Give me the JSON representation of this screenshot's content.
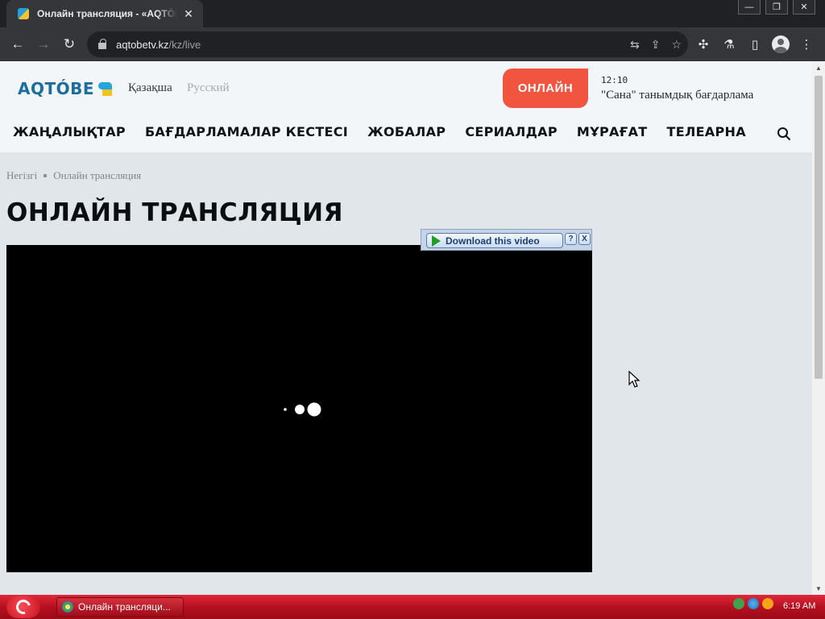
{
  "browser": {
    "tab_title": "Онлайн трансляция - «AQTÓBE",
    "tab_close": "✕",
    "window_controls": {
      "minimize": "—",
      "restore": "❐",
      "close": "✕"
    },
    "url_host": "aqtobetv.kz",
    "url_path": "/kz/live",
    "nav": {
      "back": "←",
      "forward": "→",
      "reload": "↻"
    },
    "omnibox_icons": {
      "translate": "⇆",
      "share": "⇪",
      "bookmark": "☆"
    },
    "toolbar_icons": {
      "extensions": "✣",
      "labs": "⚗",
      "sidepanel": "▯",
      "menu": "⋮"
    }
  },
  "site": {
    "logo_text": "AQTÓBE",
    "languages": {
      "active": "Қазақша",
      "other": "Русский"
    },
    "online_button": "ОНЛАЙН",
    "now_playing": {
      "time": "12:10",
      "title": "\"Сана\" танымдық бағдарлама"
    },
    "nav_items": [
      "ЖАҢАЛЫҚТАР",
      "БАҒДАРЛАМАЛАР КЕСТЕСІ",
      "ЖОБАЛАР",
      "СЕРИАЛДАР",
      "МҰРАҒАТ",
      "ТЕЛЕАРНА"
    ],
    "colors": {
      "brand_blue": "#1d6e9e",
      "brand_yellow": "#f7c21b",
      "online_red": "#f1543f"
    }
  },
  "page": {
    "breadcrumb": [
      "Негізгі",
      "Онлайн трансляция"
    ],
    "title": "ОНЛАЙН ТРАНСЛЯЦИЯ"
  },
  "player": {
    "state": "loading",
    "download_bar": {
      "label": "Download this video",
      "help": "?",
      "close": "X"
    }
  },
  "taskbar": {
    "task_label": "Онлайн трансляци...",
    "clock": "6:19 AM"
  }
}
